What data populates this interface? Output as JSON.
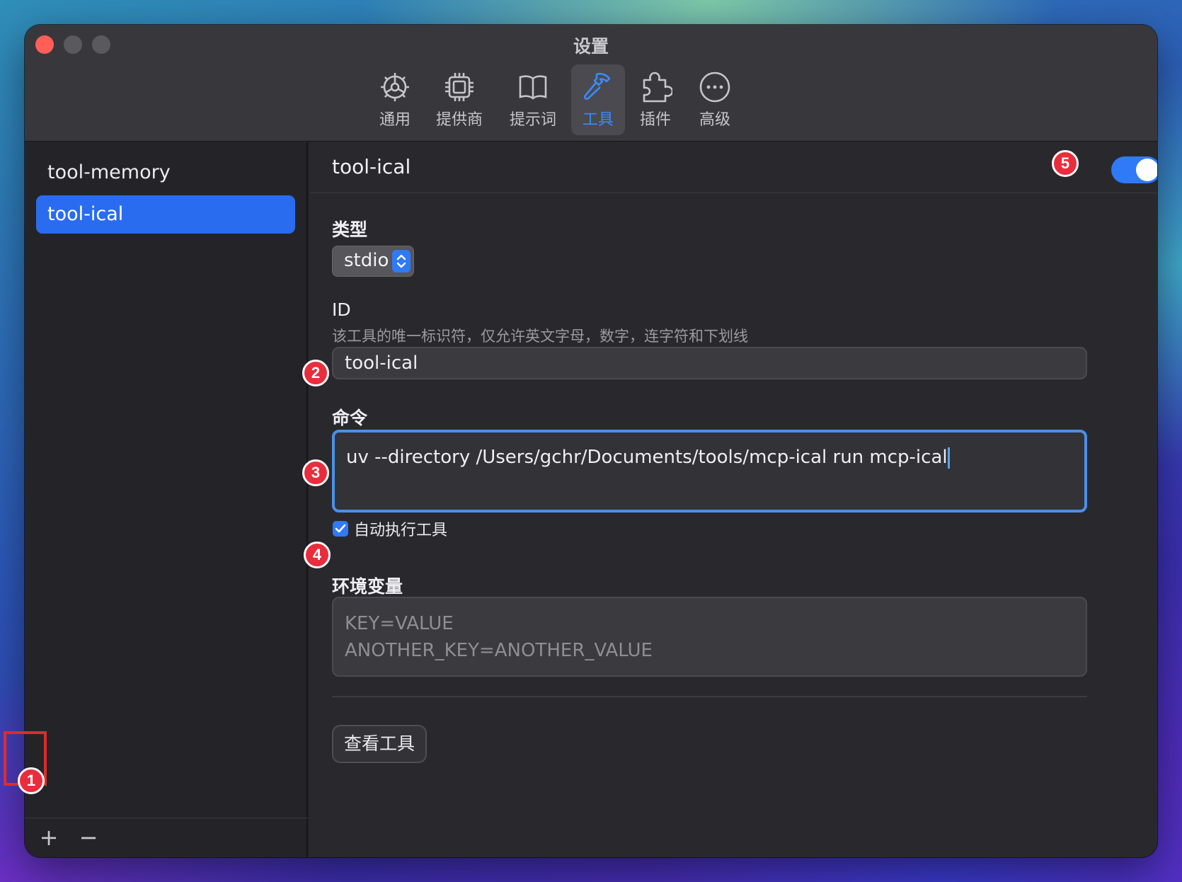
{
  "window": {
    "title": "设置"
  },
  "tabs": [
    {
      "label": "通用",
      "icon": "gear-icon"
    },
    {
      "label": "提供商",
      "icon": "cpu-chip-icon"
    },
    {
      "label": "提示词",
      "icon": "book-icon"
    },
    {
      "label": "工具",
      "icon": "hammer-icon",
      "active": true
    },
    {
      "label": "插件",
      "icon": "puzzle-icon"
    },
    {
      "label": "高级",
      "icon": "more-icon"
    }
  ],
  "sidebar": {
    "items": [
      {
        "label": "tool-memory"
      },
      {
        "label": "tool-ical",
        "selected": true
      }
    ],
    "add_label": "+",
    "remove_label": "−"
  },
  "main": {
    "title": "tool-ical",
    "enabled": true,
    "type": {
      "label": "类型",
      "value": "stdio"
    },
    "id": {
      "label": "ID",
      "help": "该工具的唯一标识符，仅允许英文字母，数字，连字符和下划线",
      "value": "tool-ical"
    },
    "command": {
      "label": "命令",
      "value": "uv --directory /Users/gchr/Documents/tools/mcp-ical run mcp-ical"
    },
    "auto_execute": {
      "label": "自动执行工具",
      "checked": true
    },
    "env": {
      "label": "环境变量",
      "placeholder_lines": [
        "KEY=VALUE",
        "ANOTHER_KEY=ANOTHER_VALUE"
      ]
    },
    "view_tools_label": "查看工具"
  },
  "annotations": [
    "1",
    "2",
    "3",
    "4",
    "5"
  ],
  "colors": {
    "accent": "#2f7af6",
    "badge": "#ea2d3c",
    "highlight": "#e02b2b"
  }
}
